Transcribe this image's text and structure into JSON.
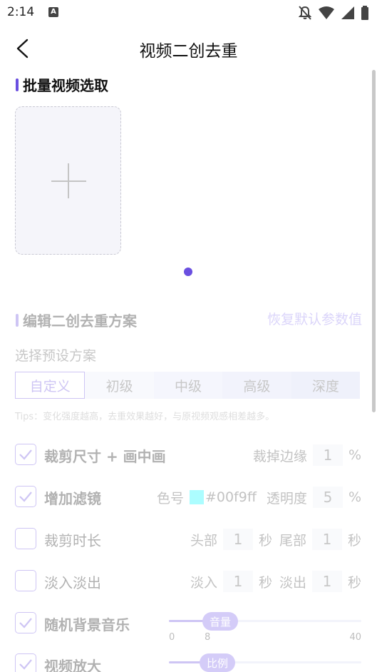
{
  "status_bar": {
    "time": "2:14",
    "notification_icon": "A"
  },
  "header": {
    "title": "视频二创去重"
  },
  "batch_section": {
    "title": "批量视频选取"
  },
  "scheme_section": {
    "title": "编辑二创去重方案",
    "restore_label": "恢复默认参数值",
    "preset_label": "选择预设方案",
    "presets": [
      "自定义",
      "初级",
      "中级",
      "高级",
      "深度"
    ],
    "selected_preset": "自定义",
    "tips": "Tips：变化强度越高，去重效果越好，与原视频观感相差越多。"
  },
  "options": {
    "crop_size": {
      "label": "裁剪尺寸 + 画中画",
      "checked": true,
      "param_label": "裁掉边缘",
      "value": "1",
      "unit": "%"
    },
    "filter": {
      "label": "增加滤镜",
      "checked": true,
      "color_label": "色号",
      "color_value": "#00f9ff",
      "color_text": "#00f9ff",
      "opacity_label": "透明度",
      "opacity_value": "5",
      "unit": "%"
    },
    "trim": {
      "label": "裁剪时长",
      "checked": false,
      "head_label": "头部",
      "head_value": "1",
      "head_unit": "秒",
      "tail_label": "尾部",
      "tail_value": "1",
      "tail_unit": "秒"
    },
    "fade": {
      "label": "淡入淡出",
      "checked": false,
      "in_label": "淡入",
      "in_value": "1",
      "in_unit": "秒",
      "out_label": "淡出",
      "out_value": "1",
      "out_unit": "秒"
    },
    "bgm": {
      "label": "随机背景音乐",
      "checked": true,
      "slider_label": "音量",
      "min": "0",
      "value": "8",
      "max": "40",
      "value_num": 8,
      "max_num": 40
    },
    "zoom": {
      "label": "视频放大",
      "checked": true,
      "slider_label": "比例",
      "fraction": 0.25
    }
  },
  "colors": {
    "accent": "#6a4fe0",
    "swatch": "#00f9ff"
  }
}
